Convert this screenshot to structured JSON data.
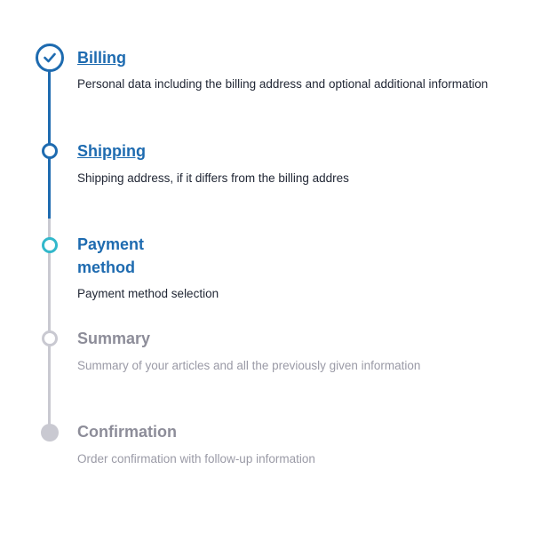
{
  "colors": {
    "accent": "#1e6bb0",
    "current": "#32b8cb",
    "inactive": "#c9c9d1",
    "text": "#1f2533",
    "muted_text": "#8d8d99"
  },
  "steps": [
    {
      "title": "Billing",
      "description": "Personal data including the billing address and optional additional information",
      "state": "completed",
      "icon": "check-icon"
    },
    {
      "title": "Shipping",
      "description": "Shipping address, if it differs from the billing addres",
      "state": "completed"
    },
    {
      "title": "Payment method",
      "description": "Payment method selection",
      "state": "current"
    },
    {
      "title": "Summary",
      "description": "Summary of your articles and all the previously given information",
      "state": "upcoming"
    },
    {
      "title": "Confirmation",
      "description": "Order confirmation with follow-up information",
      "state": "upcoming"
    }
  ]
}
